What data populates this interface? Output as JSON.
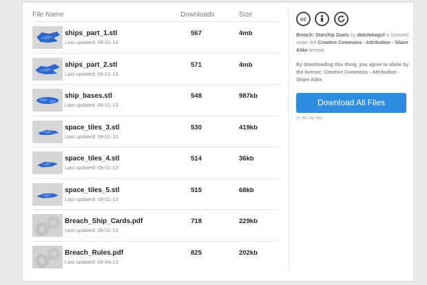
{
  "table": {
    "headers": {
      "name": "File Name",
      "downloads": "Downloads",
      "size": "Size"
    },
    "rows": [
      {
        "name": "ships_part_1.stl",
        "updated": "Last updated: 08-01-13",
        "downloads": "567",
        "size": "4mb",
        "thumb": "ship-model-icon"
      },
      {
        "name": "ships_part_2.stl",
        "updated": "Last updated: 08-01-13",
        "downloads": "571",
        "size": "4mb",
        "thumb": "ship-model-icon"
      },
      {
        "name": "ship_bases.stl",
        "updated": "Last updated: 08-01-13",
        "downloads": "548",
        "size": "987kb",
        "thumb": "ship-model-icon"
      },
      {
        "name": "space_tiles_3.stl",
        "updated": "Last updated: 08-01-13",
        "downloads": "530",
        "size": "419kb",
        "thumb": "ship-model-icon"
      },
      {
        "name": "space_tiles_4.stl",
        "updated": "Last updated: 08-01-13",
        "downloads": "514",
        "size": "36kb",
        "thumb": "ship-model-icon"
      },
      {
        "name": "space_tiles_5.stl",
        "updated": "Last updated: 08-01-13",
        "downloads": "515",
        "size": "68kb",
        "thumb": "ship-model-icon"
      },
      {
        "name": "Breach_Ship_Cards.pdf",
        "updated": "Last updated: 08-02-13",
        "downloads": "718",
        "size": "229kb",
        "thumb": "gears-icon"
      },
      {
        "name": "Breach_Rules.pdf",
        "updated": "Last updated: 08-04-13",
        "downloads": "825",
        "size": "202kb",
        "thumb": "gears-icon"
      }
    ]
  },
  "license": {
    "icons": [
      "cc-icon",
      "attribution-icon",
      "share-alike-icon"
    ],
    "title": "Breach: Starship Duels",
    "by": "by",
    "author": "dutchmogul",
    "is_licensed": "is licensed under the",
    "license_name": "Creative Commons - Attribution - Share Alike",
    "license_suffix": "license.",
    "agree": "By downloading this thing, you agree to abide by the license: Creative Commons - Attribution - Share Alike"
  },
  "download": {
    "label": "Download All Files",
    "note": "(1 mb zip file)"
  },
  "colors": {
    "accent": "#2e8de0",
    "model": "#2f66c9"
  }
}
